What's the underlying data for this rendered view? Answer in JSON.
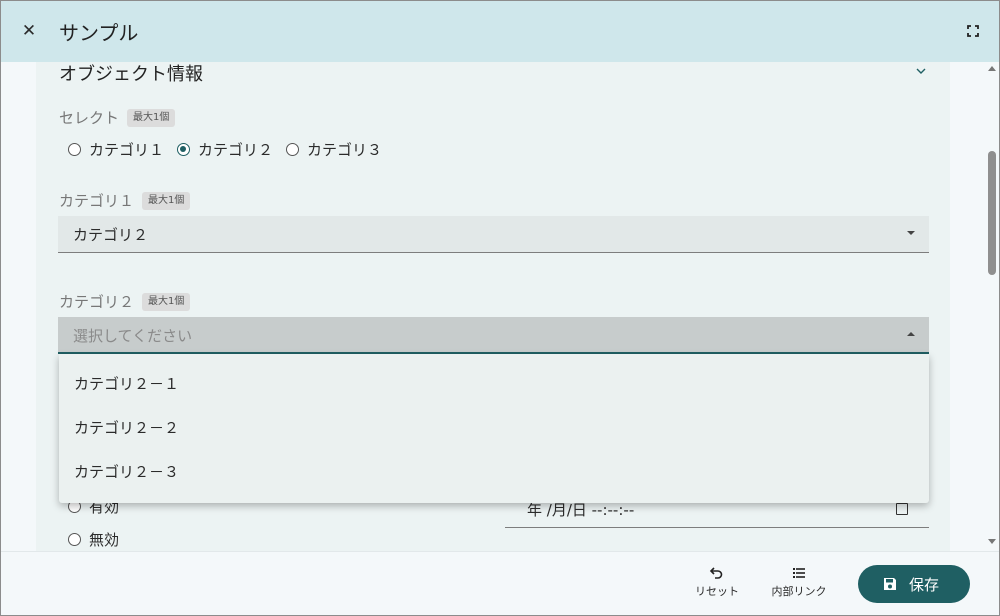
{
  "dialog": {
    "title": "サンプル",
    "close_icon": "close-icon",
    "fullscreen_icon": "fullscreen-icon"
  },
  "section": {
    "title": "オブジェクト情報",
    "chevron_icon": "chevron-down-icon"
  },
  "select_field": {
    "label": "セレクト",
    "badge": "最大1個",
    "options": [
      {
        "label": "カテゴリ１",
        "checked": false
      },
      {
        "label": "カテゴリ２",
        "checked": true
      },
      {
        "label": "カテゴリ３",
        "checked": false
      }
    ]
  },
  "category1": {
    "label": "カテゴリ１",
    "badge": "最大1個",
    "value": "カテゴリ２"
  },
  "category2": {
    "label": "カテゴリ２",
    "badge": "最大1個",
    "placeholder": "選択してください",
    "menu_items": [
      "カテゴリ２－１",
      "カテゴリ２－２",
      "カテゴリ２－３"
    ]
  },
  "validity": {
    "options": [
      "有効",
      "無効"
    ]
  },
  "datetime": {
    "value": "年 /月/日 --:--:--",
    "icon": "calendar-icon"
  },
  "footer": {
    "reset_label": "リセット",
    "reset_icon": "undo-icon",
    "link_label": "内部リンク",
    "link_icon": "list-icon",
    "save_label": "保存",
    "save_icon": "save-icon"
  },
  "colors": {
    "header_bg": "#cfe7eb",
    "accent": "#1f5f63",
    "card_bg": "#ecf3f3"
  }
}
